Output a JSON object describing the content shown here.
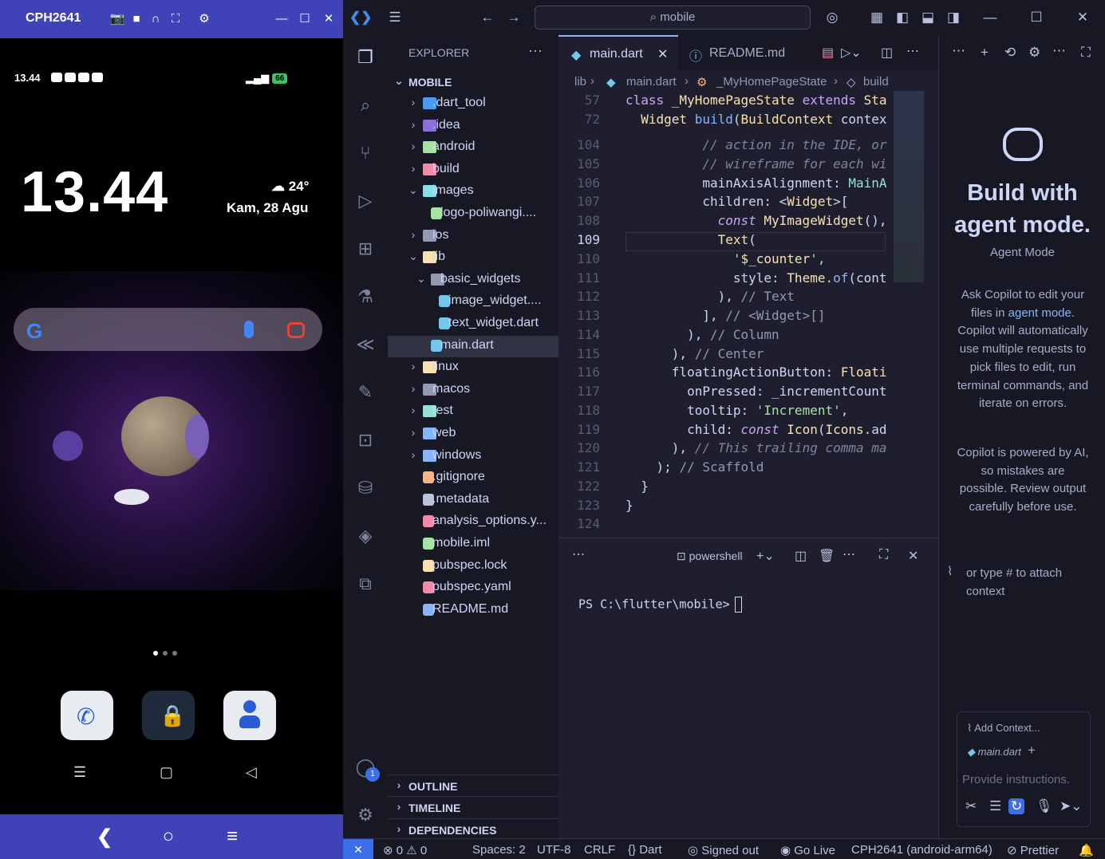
{
  "phone": {
    "window_title": "CPH2641",
    "status_time": "13.44",
    "battery": "66",
    "clock": "13.44",
    "weather_temp": "24°",
    "date": "Kam, 28 Agu"
  },
  "titlebar": {
    "command_center": "mobile"
  },
  "activity_badge": "1",
  "explorer": {
    "title": "EXPLORER",
    "root": "MOBILE",
    "items": [
      {
        "label": ".dart_tool",
        "color": "#4a9cf0"
      },
      {
        "label": ".idea",
        "color": "#8c6fd8"
      },
      {
        "label": "android",
        "color": "#a6e3a1"
      },
      {
        "label": "build",
        "color": "#f38ba8"
      },
      {
        "label": "images",
        "color": "#89dceb"
      },
      {
        "label": "logo-poliwangi....",
        "color": "#a6e3a1"
      },
      {
        "label": "ios",
        "color": "#9399b2"
      },
      {
        "label": "lib",
        "color": "#f9e2af"
      },
      {
        "label": "basic_widgets",
        "color": "#9399b2"
      },
      {
        "label": "image_widget....",
        "color": "#74c7ec"
      },
      {
        "label": "text_widget.dart",
        "color": "#74c7ec"
      },
      {
        "label": "main.dart",
        "color": "#74c7ec"
      },
      {
        "label": "linux",
        "color": "#f9e2af"
      },
      {
        "label": "macos",
        "color": "#9399b2"
      },
      {
        "label": "test",
        "color": "#94e2d5"
      },
      {
        "label": "web",
        "color": "#89b4fa"
      },
      {
        "label": "windows",
        "color": "#89b4fa"
      },
      {
        "label": ".gitignore",
        "color": "#fab387"
      },
      {
        "label": ".metadata",
        "color": "#bac2de"
      },
      {
        "label": "analysis_options.y...",
        "color": "#f38ba8"
      },
      {
        "label": "mobile.iml",
        "color": "#a6e3a1"
      },
      {
        "label": "pubspec.lock",
        "color": "#f9e2af"
      },
      {
        "label": "pubspec.yaml",
        "color": "#f38ba8"
      },
      {
        "label": "README.md",
        "color": "#89b4fa"
      }
    ],
    "sections": [
      "OUTLINE",
      "TIMELINE",
      "DEPENDENCIES"
    ]
  },
  "tabs": [
    {
      "label": "main.dart"
    },
    {
      "label": "README.md"
    }
  ],
  "breadcrumb": [
    "lib",
    "main.dart",
    "_MyHomePageState",
    "build"
  ],
  "code": [
    {
      "n": "57",
      "segs": [
        [
          "class ",
          "k"
        ],
        [
          "_MyHomePageState ",
          "t"
        ],
        [
          "extends ",
          "k"
        ],
        [
          "Sta",
          "t"
        ]
      ]
    },
    {
      "n": "72",
      "segs": [
        [
          "  Widget ",
          "t"
        ],
        [
          "build",
          "f"
        ],
        [
          "(",
          ""
        ],
        [
          "BuildContext ",
          "t"
        ],
        [
          "contex",
          ""
        ]
      ]
    },
    {
      "n": "104",
      "segs": [
        [
          "          // action in the IDE, or",
          "c"
        ]
      ]
    },
    {
      "n": "105",
      "segs": [
        [
          "          // wireframe for each wi",
          "c"
        ]
      ]
    },
    {
      "n": "106",
      "segs": [
        [
          "          mainAxisAlignment: ",
          ""
        ],
        [
          "MainA",
          "p"
        ]
      ]
    },
    {
      "n": "107",
      "segs": [
        [
          "          children: <",
          ""
        ],
        [
          "Widget",
          "t"
        ],
        [
          ">[",
          ""
        ]
      ]
    },
    {
      "n": "108",
      "segs": [
        [
          "            const ",
          "ki"
        ],
        [
          "MyImageWidget",
          "t"
        ],
        [
          "(),",
          ""
        ]
      ]
    },
    {
      "n": "109",
      "segs": [
        [
          "            ",
          ""
        ],
        [
          "Text",
          "t"
        ],
        [
          "(",
          ""
        ]
      ]
    },
    {
      "n": "110",
      "segs": [
        [
          "              '",
          "s"
        ],
        [
          "$_counter",
          "t"
        ],
        [
          "',",
          "s"
        ]
      ]
    },
    {
      "n": "111",
      "segs": [
        [
          "              style: ",
          ""
        ],
        [
          "Theme",
          "t"
        ],
        [
          ".",
          ""
        ],
        [
          "of",
          "f"
        ],
        [
          "(cont",
          ""
        ]
      ]
    },
    {
      "n": "112",
      "segs": [
        [
          "            ), ",
          ""
        ],
        [
          "// Text",
          "cc"
        ]
      ]
    },
    {
      "n": "113",
      "segs": [
        [
          "          ], ",
          ""
        ],
        [
          "// <Widget>[]",
          "cc"
        ]
      ]
    },
    {
      "n": "114",
      "segs": [
        [
          "        ), ",
          ""
        ],
        [
          "// Column",
          "cc"
        ]
      ]
    },
    {
      "n": "115",
      "segs": [
        [
          "      ), ",
          ""
        ],
        [
          "// Center",
          "cc"
        ]
      ]
    },
    {
      "n": "116",
      "segs": [
        [
          "      floatingActionButton: ",
          ""
        ],
        [
          "Floati",
          "t"
        ]
      ]
    },
    {
      "n": "117",
      "segs": [
        [
          "        onPressed: _incrementCount",
          ""
        ]
      ]
    },
    {
      "n": "118",
      "segs": [
        [
          "        tooltip: ",
          ""
        ],
        [
          "'Increment'",
          "s"
        ],
        [
          ",",
          ""
        ]
      ]
    },
    {
      "n": "119",
      "segs": [
        [
          "        child: ",
          ""
        ],
        [
          "const ",
          "ki"
        ],
        [
          "Icon",
          "t"
        ],
        [
          "(",
          ""
        ],
        [
          "Icons",
          "t"
        ],
        [
          ".ad",
          ""
        ]
      ]
    },
    {
      "n": "120",
      "segs": [
        [
          "      ), ",
          ""
        ],
        [
          "// This trailing comma ma",
          "c"
        ]
      ]
    },
    {
      "n": "121",
      "segs": [
        [
          "    ); ",
          ""
        ],
        [
          "// Scaffold",
          "cc"
        ]
      ]
    },
    {
      "n": "122",
      "segs": [
        [
          "  }",
          ""
        ]
      ]
    },
    {
      "n": "123",
      "segs": [
        [
          "}",
          ""
        ]
      ]
    },
    {
      "n": "124",
      "segs": [
        [
          "",
          ""
        ]
      ]
    }
  ],
  "current_line": "109",
  "panel": {
    "shell": "powershell",
    "prompt": "PS C:\\flutter\\mobile>"
  },
  "chat": {
    "heading": "Build with agent mode.",
    "mode_label": "Agent Mode",
    "desc_pre": "Ask Copilot to edit your files in ",
    "desc_link": "agent mode",
    "desc_post": ". Copilot will automatically use multiple requests to pick files to edit, run terminal commands, and iterate on errors.",
    "disclaimer": "Copilot is powered by AI, so mistakes are possible. Review output carefully before use.",
    "attach_hint": "or type # to attach context",
    "add_context": "Add Context...",
    "context_file": "main.dart",
    "placeholder": "Provide instructions."
  },
  "statusbar": {
    "errors": "0",
    "warnings": "0",
    "spaces": "Spaces: 2",
    "encoding": "UTF-8",
    "eol": "CRLF",
    "language": "Dart",
    "account": "Signed out",
    "golive": "Go Live",
    "device": "CPH2641 (android-arm64)",
    "prettier": "Prettier"
  }
}
